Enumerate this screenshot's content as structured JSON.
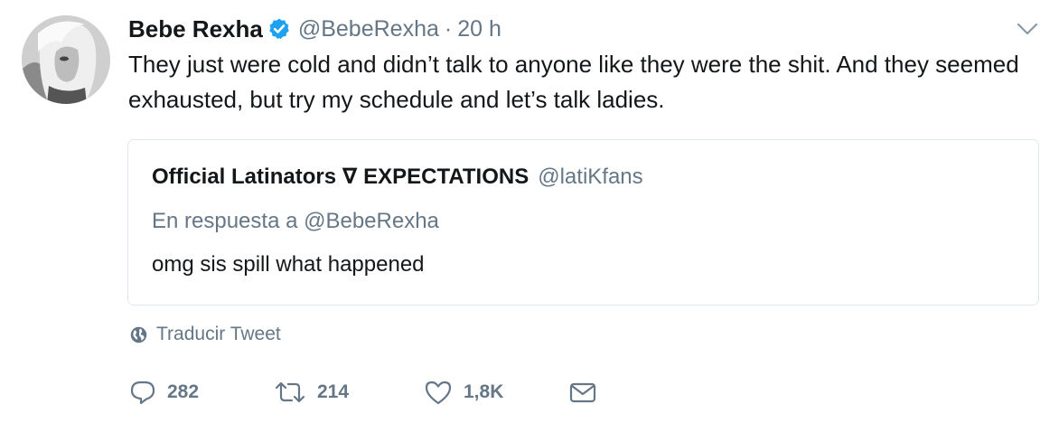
{
  "tweet": {
    "author_name": "Bebe Rexha",
    "author_handle": "@BebeRexha",
    "separator": "·",
    "time": "20 h",
    "verified": true,
    "text": "They just were cold and didn’t talk to anyone like they were the shit. And they seemed exhausted, but try my schedule and let’s talk ladies."
  },
  "quoted_tweet": {
    "author_name": "Official Latinators ∇ EXPECTATIONS",
    "author_handle": "@latiKfans",
    "reply_context": "En respuesta a @BebeRexha",
    "text": "omg sis spill what happened"
  },
  "translate_label": "Traducir Tweet",
  "actions": {
    "replies": "282",
    "retweets": "214",
    "likes": "1,8K"
  },
  "icons": {
    "verified": "verified-badge-icon",
    "more": "chevron-down-icon",
    "translate": "globe-icon",
    "reply": "reply-bubble-icon",
    "retweet": "retweet-icon",
    "like": "heart-icon",
    "message": "envelope-icon"
  },
  "colors": {
    "accent": "#1da1f2",
    "text": "#14171a",
    "secondary": "#657786",
    "border": "#e1e8ed"
  }
}
